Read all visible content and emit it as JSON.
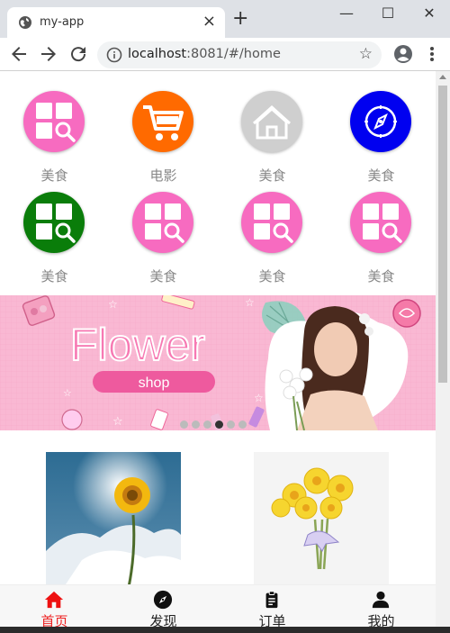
{
  "browser": {
    "tab_title": "my-app",
    "tab_close": "×",
    "new_tab": "+",
    "url_host": "localhost",
    "url_rest": ":8081/#/home",
    "window_controls": {
      "minimize": "—",
      "maximize": "☐",
      "close": "✕"
    },
    "bookmark_star": "☆"
  },
  "colors": {
    "pink": "#f76bc0",
    "orange": "#ff6a00",
    "gray": "#cfcfcf",
    "blue": "#0000f0",
    "green": "#0a7d0a",
    "active_tab": "#ee1111"
  },
  "grid": [
    {
      "label": "美食",
      "icon": "grid-search-icon",
      "color": "pink"
    },
    {
      "label": "电影",
      "icon": "cart-icon",
      "color": "orange"
    },
    {
      "label": "美食",
      "icon": "home-icon",
      "color": "gray"
    },
    {
      "label": "美食",
      "icon": "compass-icon",
      "color": "blue"
    },
    {
      "label": "美食",
      "icon": "grid-search-icon",
      "color": "green"
    },
    {
      "label": "美食",
      "icon": "grid-search-icon",
      "color": "pink"
    },
    {
      "label": "美食",
      "icon": "grid-search-icon",
      "color": "pink"
    },
    {
      "label": "美食",
      "icon": "grid-search-icon",
      "color": "pink"
    }
  ],
  "banner": {
    "headline": "Flower",
    "button": "shop",
    "dots": 6,
    "active_dot": 3
  },
  "products": [
    {
      "name": "sunflower-image"
    },
    {
      "name": "daffodil-bouquet-image"
    }
  ],
  "tabbar": [
    {
      "label": "首页",
      "icon": "home-icon",
      "active": true
    },
    {
      "label": "发现",
      "icon": "compass-icon",
      "active": false
    },
    {
      "label": "订单",
      "icon": "clipboard-icon",
      "active": false
    },
    {
      "label": "我的",
      "icon": "user-icon",
      "active": false
    }
  ]
}
